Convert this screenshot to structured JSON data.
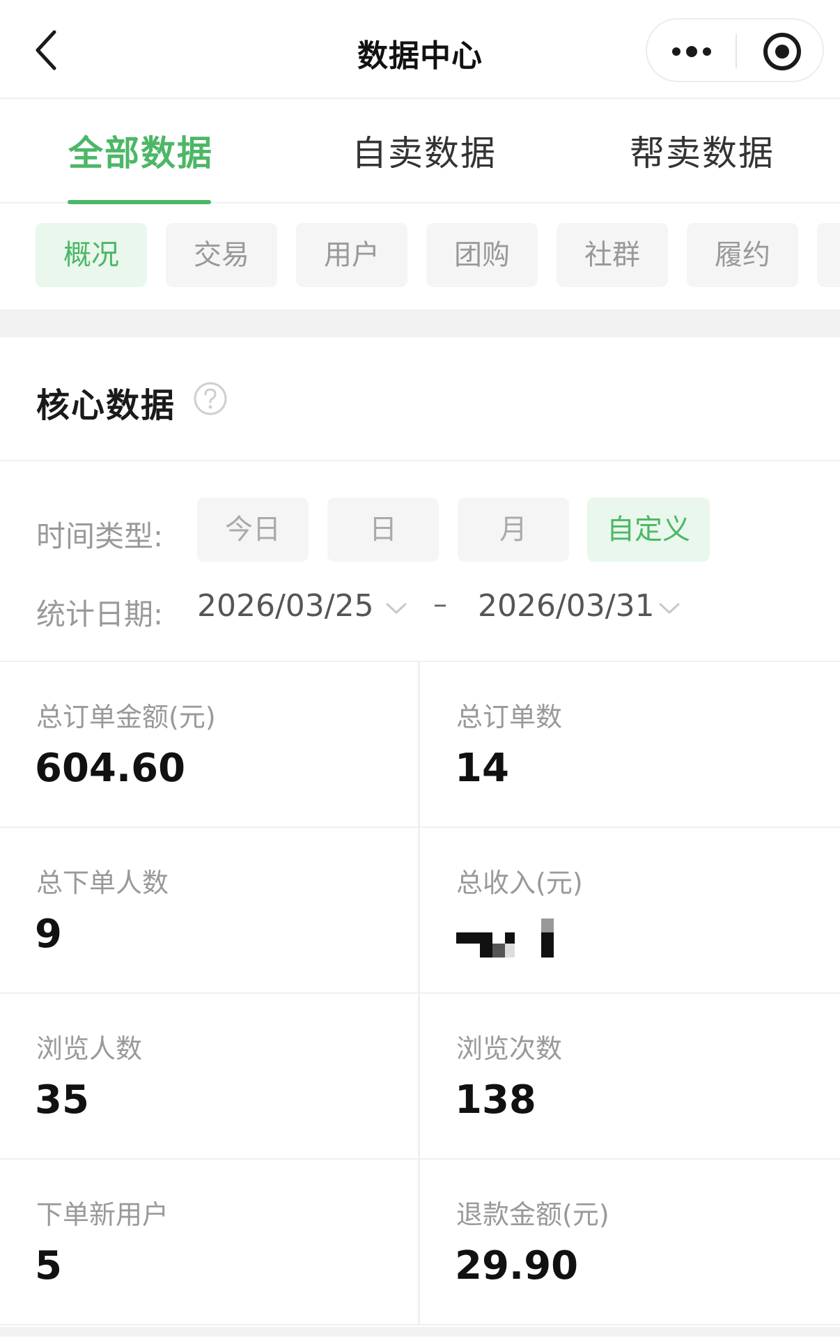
{
  "navbar": {
    "title": "数据中心",
    "back_icon": "chevron-left-icon",
    "more_icon": "more-dots-icon",
    "target_icon": "record-target-icon"
  },
  "main_tabs": [
    {
      "label": "全部数据",
      "active": true
    },
    {
      "label": "自卖数据",
      "active": false
    },
    {
      "label": "帮卖数据",
      "active": false
    }
  ],
  "sub_tabs": [
    {
      "label": "概况",
      "active": true
    },
    {
      "label": "交易",
      "active": false
    },
    {
      "label": "用户",
      "active": false
    },
    {
      "label": "团购",
      "active": false
    },
    {
      "label": "社群",
      "active": false
    },
    {
      "label": "履约",
      "active": false
    }
  ],
  "core": {
    "title": "核心数据",
    "help_icon": "question-circle-icon"
  },
  "filter": {
    "time_type_label": "时间类型:",
    "time_options": [
      {
        "label": "今日",
        "active": false
      },
      {
        "label": "日",
        "active": false
      },
      {
        "label": "月",
        "active": false
      },
      {
        "label": "自定义",
        "active": true
      }
    ],
    "date_label": "统计日期:",
    "start_date": "2026/03/25",
    "end_date": "2026/03/31",
    "separator": "–"
  },
  "metrics": [
    {
      "label": "总订单金额(元)",
      "value": "604.60"
    },
    {
      "label": "总订单数",
      "value": "14"
    },
    {
      "label": "总下单人数",
      "value": "9"
    },
    {
      "label": "总收入(元)",
      "value": null,
      "pixelated": true
    },
    {
      "label": "浏览人数",
      "value": "35"
    },
    {
      "label": "浏览次数",
      "value": "138"
    },
    {
      "label": "下单新用户",
      "value": "5"
    },
    {
      "label": "退款金额(元)",
      "value": "29.90"
    }
  ],
  "colors": {
    "accent": "#4cb766",
    "accent_bg": "#e9f7ec",
    "chip_bg": "#f5f5f5",
    "label_gray": "#999999"
  }
}
